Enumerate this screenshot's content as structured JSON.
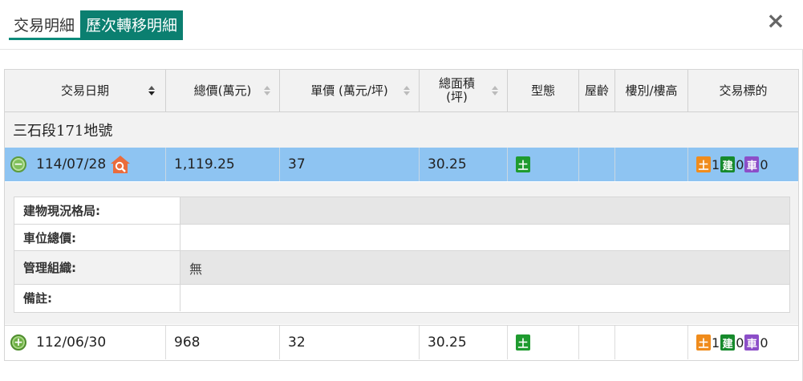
{
  "tabs": [
    "交易明細",
    "歷次轉移明細"
  ],
  "close_label": "×",
  "headers": [
    "交易日期",
    "總價(萬元)",
    "單價 (萬元/坪)",
    "總面積\n(坪)",
    "型態",
    "屋齡",
    "樓別/樓高",
    "交易標的"
  ],
  "section_title": "三石段171地號",
  "rows": [
    {
      "date": "114/07/28",
      "total_price": "1,119.25",
      "unit_price": "37",
      "area": "30.25",
      "type_badge": "土",
      "age": "",
      "floor": "",
      "targets": {
        "land_badge": "土",
        "land_count": "1",
        "bld_badge": "建",
        "bld_count": "0",
        "car_badge": "車",
        "car_count": "0"
      }
    },
    {
      "date": "112/06/30",
      "total_price": "968",
      "unit_price": "32",
      "area": "30.25",
      "type_badge": "土",
      "age": "",
      "floor": "",
      "targets": {
        "land_badge": "土",
        "land_count": "1",
        "bld_badge": "建",
        "bld_count": "0",
        "car_badge": "車",
        "car_count": "0"
      }
    }
  ],
  "detail": {
    "items": [
      {
        "label": "建物現況格局:",
        "value": ""
      },
      {
        "label": "車位總價:",
        "value": ""
      },
      {
        "label": "管理組織:",
        "value": "無"
      },
      {
        "label": "備註:",
        "value": ""
      }
    ]
  },
  "colors": {
    "accent": "#0b7f70",
    "selected_row": "#8ec4f2",
    "land_badge": "#1f9b2f",
    "land_target_badge": "#f08c1c",
    "car_badge": "#8c4ec8"
  }
}
